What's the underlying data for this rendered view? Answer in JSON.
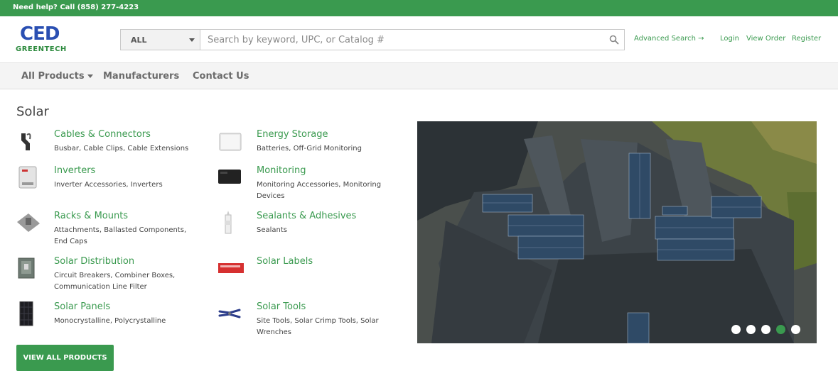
{
  "topbar": {
    "help_text": "Need help? Call (858) 277-4223"
  },
  "logo": {
    "line1": "CED",
    "line2": "GREENTECH"
  },
  "search": {
    "category": "ALL",
    "placeholder": "Search by keyword, UPC, or Catalog #",
    "advanced": "Advanced Search →"
  },
  "header_links": [
    "Login",
    "View Order",
    "Register"
  ],
  "nav": {
    "all_products": "All Products",
    "manufacturers": "Manufacturers",
    "contact": "Contact Us"
  },
  "section_title": "Solar",
  "categories": [
    {
      "name": "Cables & Connectors",
      "sub": "Busbar, Cable Clips, Cable Extensions"
    },
    {
      "name": "Energy Storage",
      "sub": "Batteries, Off-Grid Monitoring"
    },
    {
      "name": "Inverters",
      "sub": "Inverter Accessories, Inverters"
    },
    {
      "name": "Monitoring",
      "sub": "Monitoring Accessories, Monitoring Devices"
    },
    {
      "name": "Racks & Mounts",
      "sub": "Attachments, Ballasted Components, End Caps"
    },
    {
      "name": "Sealants & Adhesives",
      "sub": "Sealants"
    },
    {
      "name": "Solar Distribution",
      "sub": "Circuit Breakers, Combiner Boxes, Communication Line Filter"
    },
    {
      "name": "Solar Labels",
      "sub": ""
    },
    {
      "name": "Solar Panels",
      "sub": "Monocrystalline, Polycrystalline"
    },
    {
      "name": "Solar Tools",
      "sub": "Site Tools, Solar Crimp Tools, Solar Wrenches"
    }
  ],
  "view_all": "VIEW ALL PRODUCTS",
  "carousel": {
    "slide_count": 5,
    "active_index": 3
  },
  "colors": {
    "brand_green": "#3a9a4f",
    "logo_blue": "#2a4fb2"
  }
}
